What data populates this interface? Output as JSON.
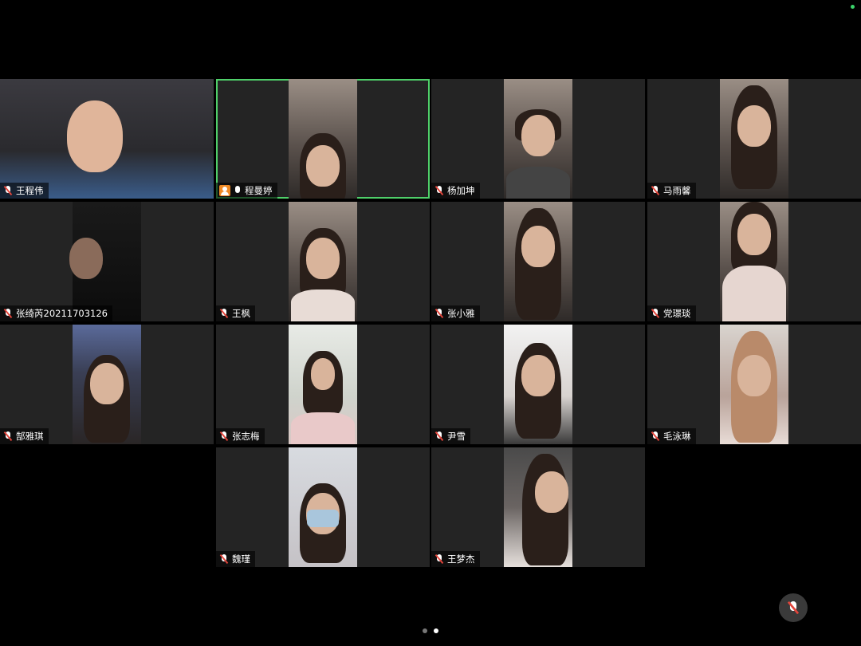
{
  "meeting": {
    "participants": [
      {
        "name": "王程伟",
        "mic": "muted",
        "host": false,
        "active": false
      },
      {
        "name": "程曼婷",
        "mic": "on",
        "host": true,
        "active": true
      },
      {
        "name": "杨加坤",
        "mic": "muted",
        "host": false,
        "active": false
      },
      {
        "name": "马雨馨",
        "mic": "muted",
        "host": false,
        "active": false
      },
      {
        "name": "张绮芮20211703126",
        "mic": "muted",
        "host": false,
        "active": false
      },
      {
        "name": "王枫",
        "mic": "muted",
        "host": false,
        "active": false
      },
      {
        "name": "张小雅",
        "mic": "muted",
        "host": false,
        "active": false
      },
      {
        "name": "党璟琰",
        "mic": "muted",
        "host": false,
        "active": false
      },
      {
        "name": "郜雅琪",
        "mic": "muted",
        "host": false,
        "active": false
      },
      {
        "name": "张志梅",
        "mic": "muted",
        "host": false,
        "active": false
      },
      {
        "name": "尹雪",
        "mic": "muted",
        "host": false,
        "active": false
      },
      {
        "name": "毛泳琳",
        "mic": "muted",
        "host": false,
        "active": false
      },
      {
        "name": "魏瑾",
        "mic": "muted",
        "host": false,
        "active": false
      },
      {
        "name": "王梦杰",
        "mic": "muted",
        "host": false,
        "active": false
      }
    ]
  },
  "pager": {
    "pages": 2,
    "current": 2
  },
  "controls": {
    "mute_icon": "mic-muted-icon"
  },
  "colors": {
    "active_border": "#4fd06a",
    "host_badge": "#f08a24",
    "tile_bg": "#242424"
  }
}
